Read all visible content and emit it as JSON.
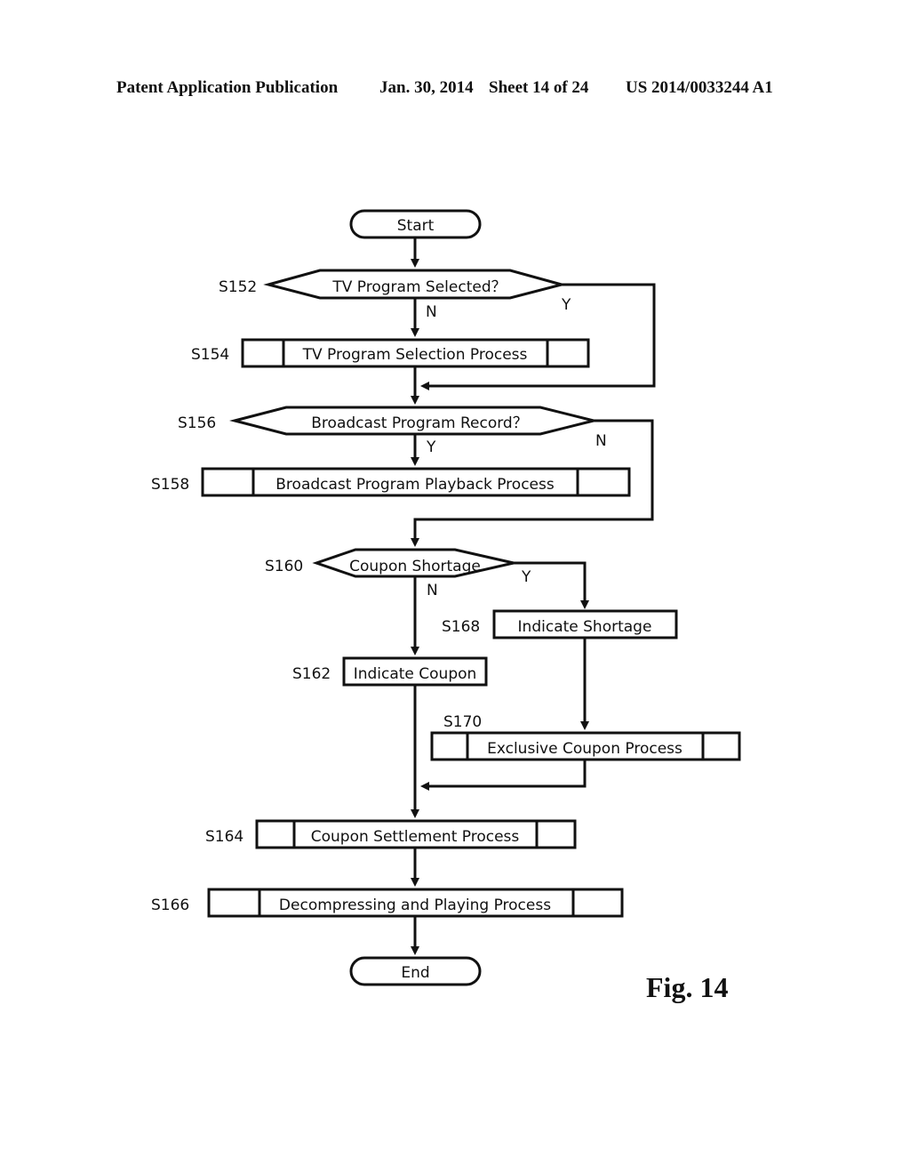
{
  "header": {
    "publication": "Patent Application Publication",
    "date": "Jan. 30, 2014",
    "sheet": "Sheet 14 of 24",
    "number": "US 2014/0033244 A1"
  },
  "figure_label": "Fig. 14",
  "flowchart": {
    "start": "Start",
    "end": "End",
    "steps": {
      "s152": {
        "id": "S152",
        "text": "TV Program Selected？",
        "type": "decision",
        "yes": "Y",
        "no": "N"
      },
      "s154": {
        "id": "S154",
        "text": "TV Program Selection Process",
        "type": "predefined-process"
      },
      "s156": {
        "id": "S156",
        "text": "Broadcast Program Record？",
        "type": "decision",
        "yes": "Y",
        "no": "N"
      },
      "s158": {
        "id": "S158",
        "text": "Broadcast Program Playback Process",
        "type": "predefined-process"
      },
      "s160": {
        "id": "S160",
        "text": "Coupon Shortage",
        "type": "decision",
        "yes": "Y",
        "no": "N"
      },
      "s162": {
        "id": "S162",
        "text": "Indicate Coupon",
        "type": "process"
      },
      "s164": {
        "id": "S164",
        "text": "Coupon Settlement Process",
        "type": "predefined-process"
      },
      "s166": {
        "id": "S166",
        "text": "Decompressing and Playing Process",
        "type": "predefined-process"
      },
      "s168": {
        "id": "S168",
        "text": "Indicate Shortage",
        "type": "process"
      },
      "s170": {
        "id": "S170",
        "text": "Exclusive Coupon Process",
        "type": "predefined-process"
      }
    }
  }
}
